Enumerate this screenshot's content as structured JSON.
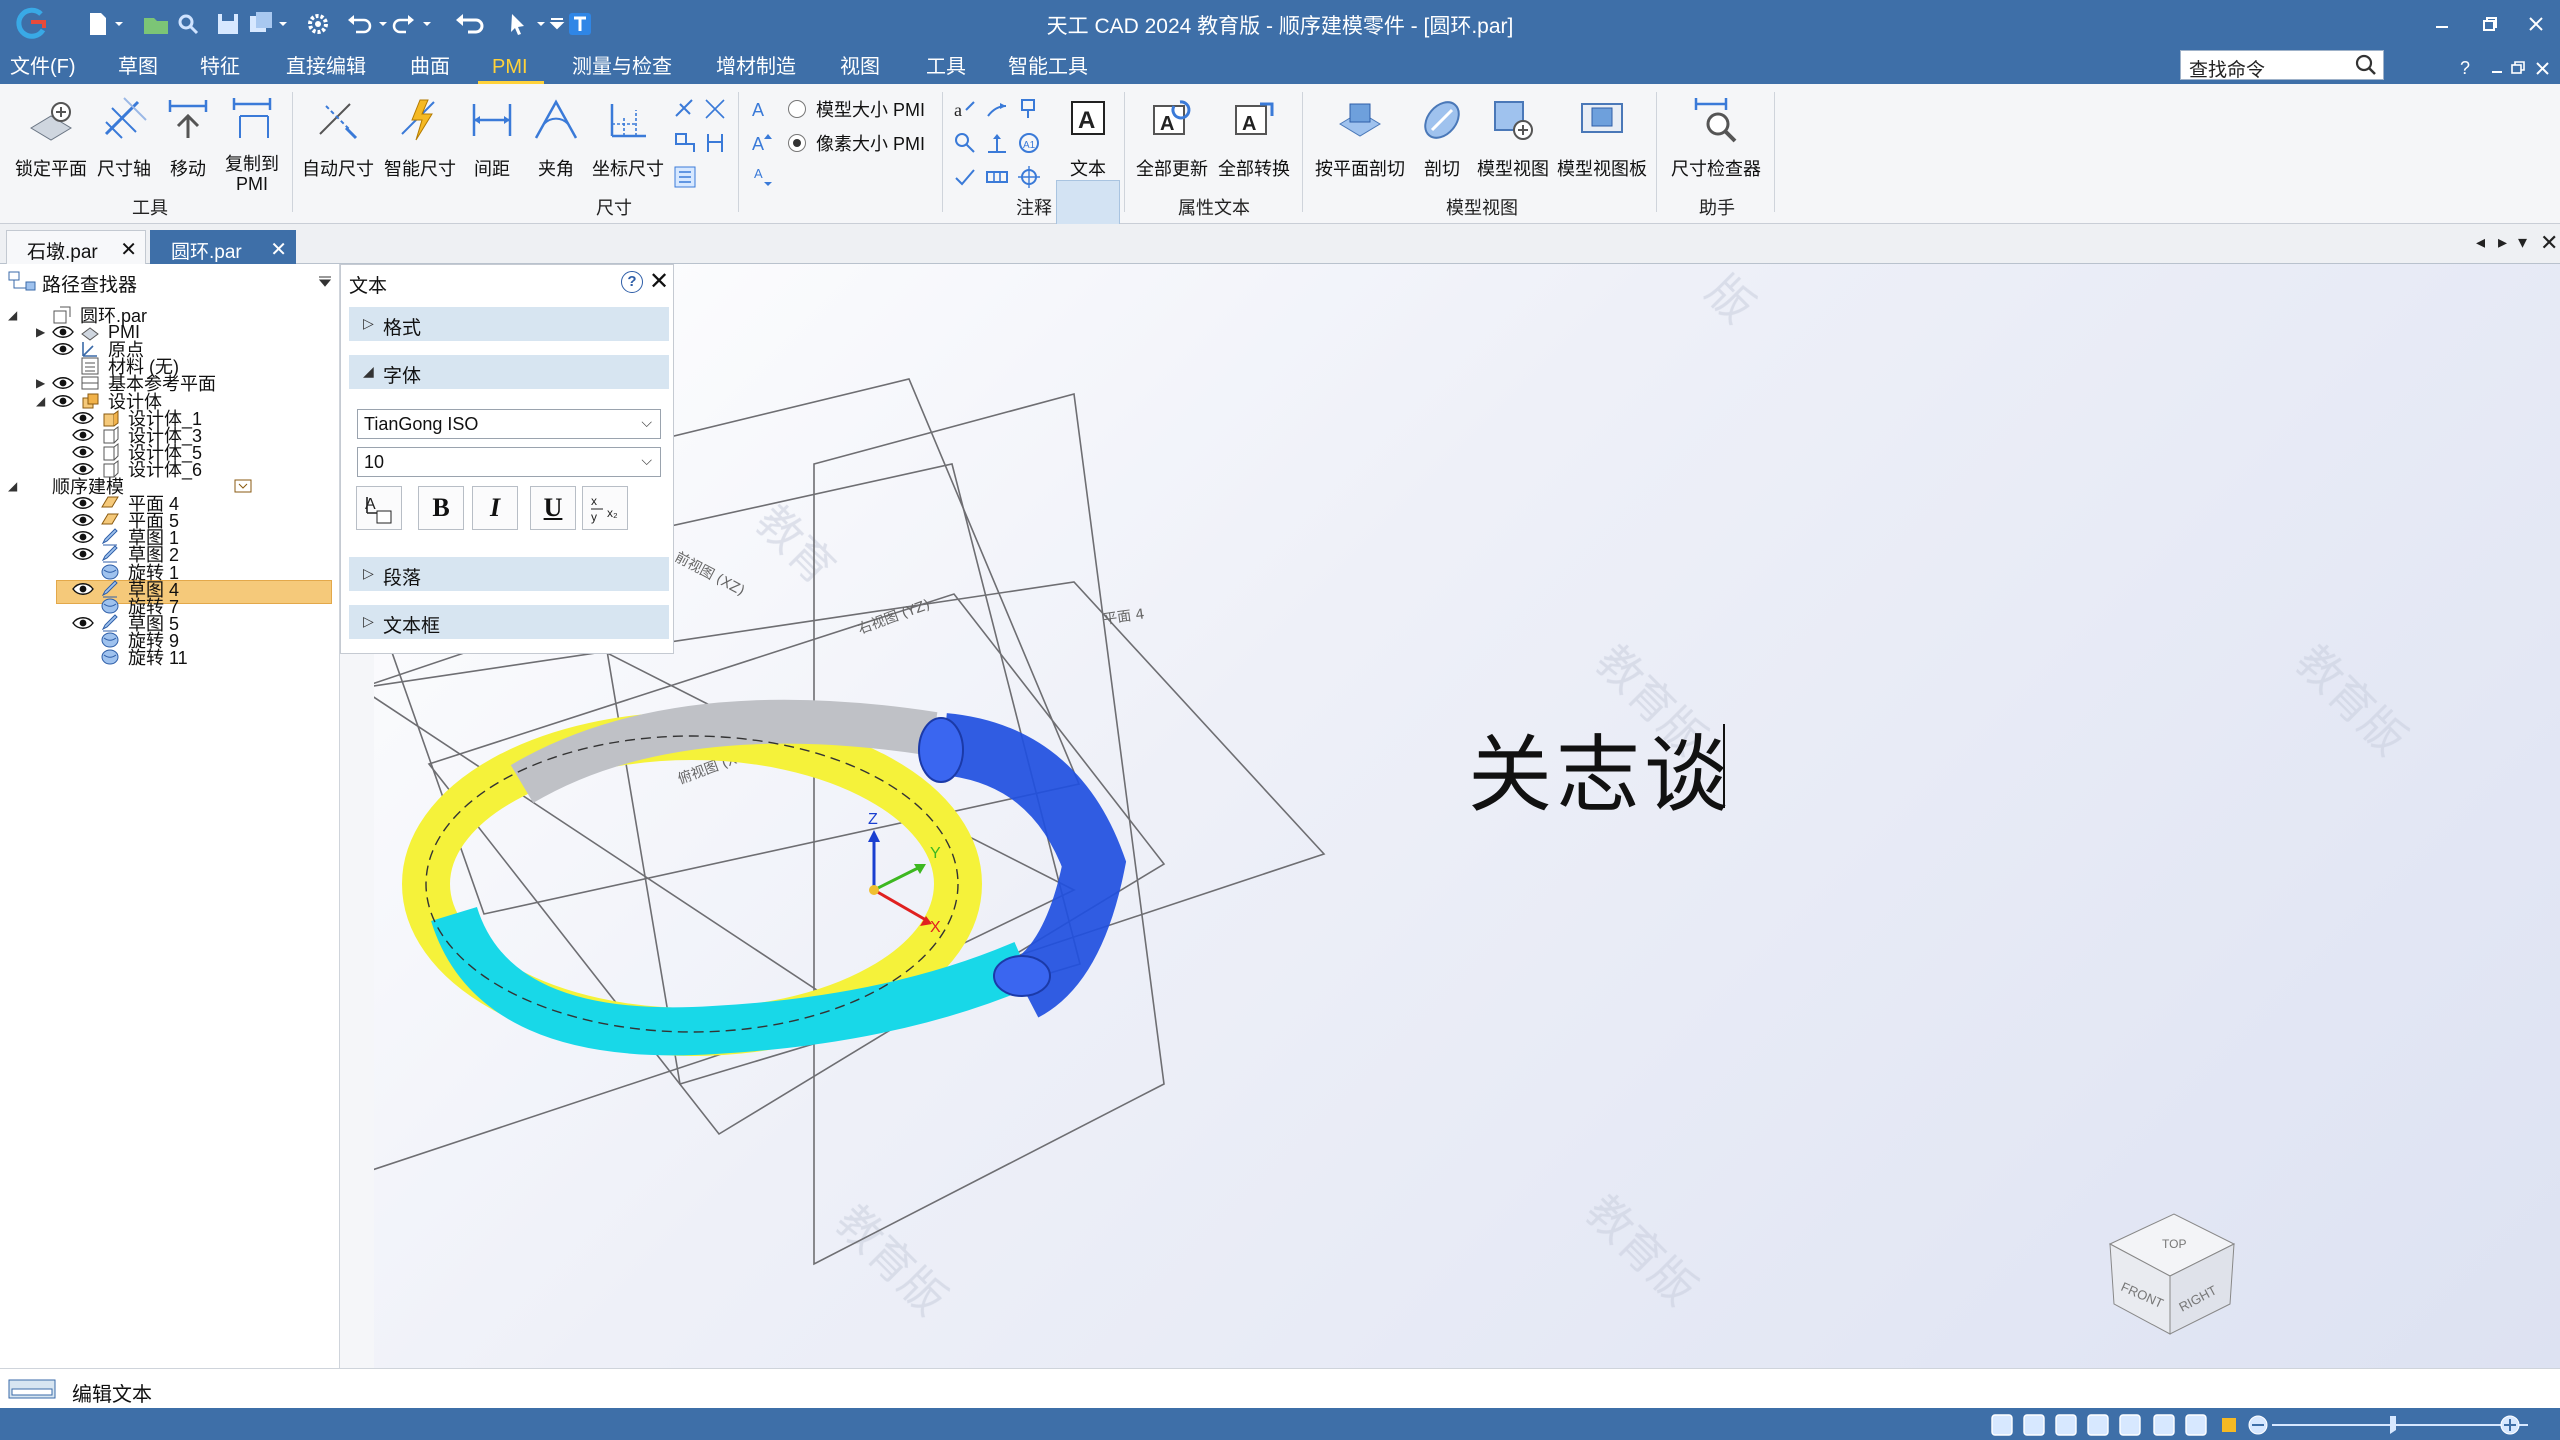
{
  "app": {
    "window_title": "天工 CAD 2024 教育版 - 顺序建模零件 - [圆环.par]"
  },
  "menu": {
    "items": [
      "文件(F)",
      "草图",
      "特征",
      "直接编辑",
      "曲面",
      "PMI",
      "测量与检查",
      "增材制造",
      "视图",
      "工具",
      "智能工具"
    ],
    "active": "PMI"
  },
  "search": {
    "value": "查找命令"
  },
  "ribbon": {
    "tools": {
      "lock_plane": "锁定平面",
      "ruler_axis": "尺寸轴",
      "move": "移动",
      "copy_to_pmi_l1": "复制到",
      "copy_to_pmi_l2": "PMI",
      "group": "工具"
    },
    "dimensions": {
      "auto_dim": "自动尺寸",
      "smart_dim": "智能尺寸",
      "spacing": "间距",
      "angle": "夹角",
      "coord_dim": "坐标尺寸",
      "group": "尺寸"
    },
    "pmi_size": {
      "model_size": "模型大小 PMI",
      "pixel_size": "像素大小 PMI"
    },
    "annotation": {
      "text": "文本",
      "group": "注释"
    },
    "attr_text": {
      "update_all": "全部更新",
      "convert_all": "全部转换",
      "group": "属性文本"
    },
    "model_view": {
      "section_plane": "按平面剖切",
      "section": "剖切",
      "model_view": "模型视图",
      "view_board": "模型视图板",
      "group": "模型视图"
    },
    "assistant": {
      "dim_checker": "尺寸检查器",
      "group": "助手"
    }
  },
  "tabs": [
    {
      "label": "石墩.par",
      "active": false
    },
    {
      "label": "圆环.par",
      "active": true
    }
  ],
  "pathfinder": {
    "title": "路径查找器",
    "tree": [
      {
        "label": "圆环.par",
        "indent": 0,
        "expand": "down",
        "eye": false,
        "icon": "part-icon"
      },
      {
        "label": "PMI",
        "indent": 1,
        "expand": "right",
        "eye": true,
        "icon": "pmi-icon"
      },
      {
        "label": "原点",
        "indent": 1,
        "expand": "",
        "eye": true,
        "icon": "origin-icon"
      },
      {
        "label": "材料 (无)",
        "indent": 1,
        "expand": "",
        "eye": false,
        "icon": "material-icon"
      },
      {
        "label": "基本参考平面",
        "indent": 1,
        "expand": "right",
        "eye": true,
        "icon": "ref-planes-icon"
      },
      {
        "label": "设计体",
        "indent": 1,
        "expand": "down",
        "eye": true,
        "icon": "design-body-icon"
      },
      {
        "label": "设计体_1",
        "indent": 2,
        "expand": "",
        "eye": true,
        "icon": "body-icon"
      },
      {
        "label": "设计体_3",
        "indent": 2,
        "expand": "",
        "eye": true,
        "icon": "body-outline-icon"
      },
      {
        "label": "设计体_5",
        "indent": 2,
        "expand": "",
        "eye": true,
        "icon": "body-outline-icon"
      },
      {
        "label": "设计体_6",
        "indent": 2,
        "expand": "",
        "eye": true,
        "icon": "body-outline-icon"
      },
      {
        "label": "顺序建模",
        "indent": 0,
        "expand": "down",
        "eye": false,
        "icon": "",
        "highlight": true
      },
      {
        "label": "平面 4",
        "indent": 2,
        "expand": "",
        "eye": true,
        "icon": "plane-icon"
      },
      {
        "label": "平面 5",
        "indent": 2,
        "expand": "",
        "eye": true,
        "icon": "plane-icon"
      },
      {
        "label": "草图 1",
        "indent": 2,
        "expand": "",
        "eye": true,
        "icon": "sketch-icon"
      },
      {
        "label": "草图 2",
        "indent": 2,
        "expand": "",
        "eye": true,
        "icon": "sketch-icon"
      },
      {
        "label": "旋转 1",
        "indent": 2,
        "expand": "",
        "eye": false,
        "icon": "revolve-icon"
      },
      {
        "label": "草图 4",
        "indent": 2,
        "expand": "",
        "eye": true,
        "icon": "sketch-icon"
      },
      {
        "label": "旋转 7",
        "indent": 2,
        "expand": "",
        "eye": false,
        "icon": "revolve-icon"
      },
      {
        "label": "草图 5",
        "indent": 2,
        "expand": "",
        "eye": true,
        "icon": "sketch-icon"
      },
      {
        "label": "旋转 9",
        "indent": 2,
        "expand": "",
        "eye": false,
        "icon": "revolve-icon"
      },
      {
        "label": "旋转 11",
        "indent": 2,
        "expand": "",
        "eye": false,
        "icon": "revolve-icon"
      }
    ]
  },
  "text_panel": {
    "title": "文本",
    "sections": {
      "format": "格式",
      "font": "字体",
      "paragraph": "段落",
      "textbox": "文本框"
    },
    "font_name": "TianGong ISO",
    "font_size": "10",
    "buttons": {
      "bold": "B",
      "italic": "I",
      "underline": "U"
    }
  },
  "viewport": {
    "annotation_text": "关志谈",
    "plane_labels": {
      "front": "前视图 (XZ)",
      "right": "右视图 (YZ)",
      "plane4": "平面 4",
      "top": "俯视图 (XY)"
    },
    "axis_labels": {
      "x": "X",
      "y": "Y",
      "z": "Z"
    },
    "watermark": "教育版",
    "viewcube": {
      "front": "FRONT",
      "right": "RIGHT",
      "top": "TOP"
    }
  },
  "status": {
    "prompt": "编辑文本"
  },
  "colors": {
    "title_bg": "#3e6fa8",
    "accent": "#ffd23a",
    "torus_blue": "#1f4fe0",
    "torus_cyan": "#18d8e8",
    "torus_yellow": "#f5f23a",
    "highlight": "#f5c97a"
  }
}
